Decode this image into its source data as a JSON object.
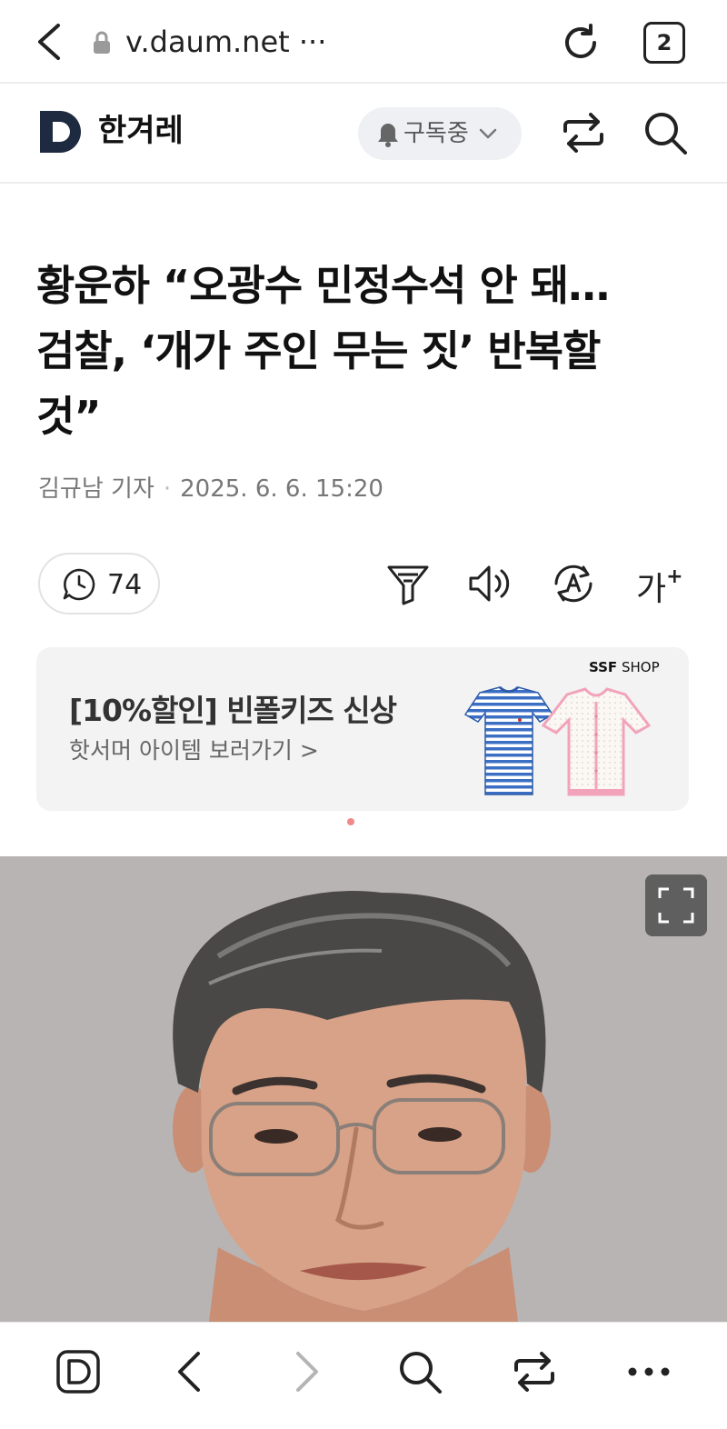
{
  "browser": {
    "url": "v.daum.net ···",
    "tab_count": "2"
  },
  "header": {
    "logo_icon": "daum-d-logo",
    "press_name": "한겨레",
    "subscribe_label": "구독중",
    "share_icon": "share-icon",
    "search_icon": "search-icon"
  },
  "article": {
    "headline_lines": [
      "황운하 “오광수 민정수석 안 돼…",
      "검찰, ‘개가 주인 무는 짓’ 반복할",
      "것”"
    ],
    "reporter": "김규남 기자",
    "timestamp": "2025. 6. 6. 15:20"
  },
  "tools": {
    "comment_count": "74",
    "font_size_label": "가",
    "font_size_plus": "+",
    "icons": [
      "comment-icon",
      "summary-filter-icon",
      "read-aloud-icon",
      "translate-icon",
      "font-size-icon"
    ]
  },
  "ad": {
    "title": "[10%할인] 빈폴키즈 신상",
    "subtitle": "핫서머 아이템 보러가기 >",
    "brand_bold": "SSF",
    "brand_rest": " SHOP"
  },
  "bottom_nav": {
    "icons": [
      "daum-home-icon",
      "back-icon",
      "forward-icon",
      "search-icon",
      "share-icon",
      "more-icon"
    ]
  },
  "colors": {
    "accent_dark": "#1e2a3f",
    "photo_bg": "#b8b4b3",
    "ad_bg": "#f3f3f3"
  }
}
